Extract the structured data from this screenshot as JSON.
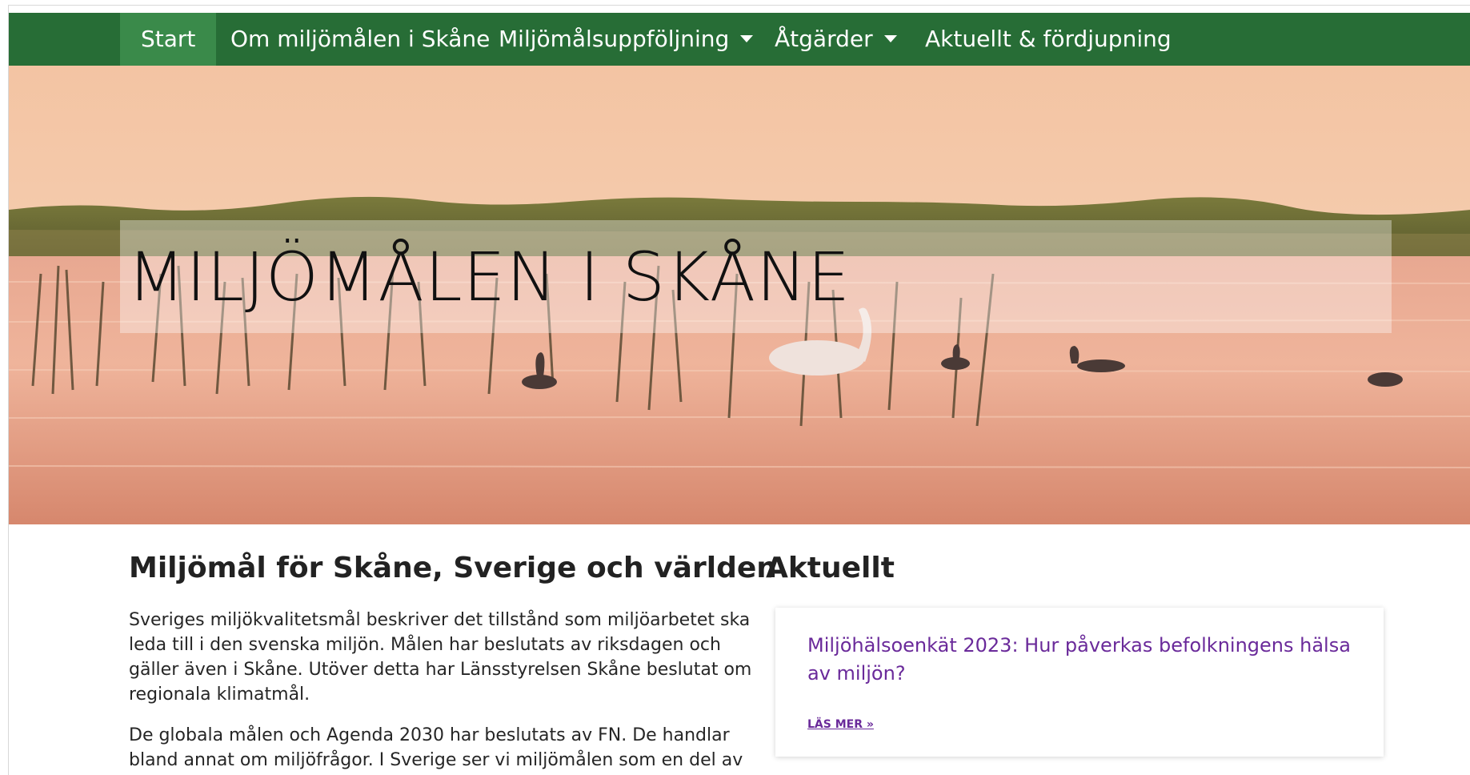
{
  "nav": {
    "items": [
      {
        "label": "Start",
        "active": true,
        "dropdown": false
      },
      {
        "label": "Om miljömålen i Skåne",
        "active": false,
        "dropdown": false
      },
      {
        "label": "Miljömålsuppföljning",
        "active": false,
        "dropdown": true
      },
      {
        "label": "Åtgärder",
        "active": false,
        "dropdown": true
      },
      {
        "label": "Aktuellt & fördjupning",
        "active": false,
        "dropdown": false
      }
    ],
    "color": "#276d36",
    "active_color": "#3a8a4a"
  },
  "hero": {
    "title": "MILJÖMÅLEN I SKÅNE",
    "image": "lake-with-reeds-and-swans-at-sunset"
  },
  "main": {
    "heading": "Miljömål för Skåne, Sverige och världen",
    "paragraphs": [
      "Sveriges miljökvalitetsmål beskriver det tillstånd som miljöarbetet ska leda till i den svenska miljön. Målen har beslutats av riksdagen och gäller även i Skåne. Utöver detta har Länsstyrelsen Skåne beslutat om regionala klimatmål.",
      "De globala målen och Agenda 2030 har beslutats av FN. De handlar bland annat om miljöfrågor. I Sverige ser vi miljömålen som en del av"
    ]
  },
  "aktuellt": {
    "heading": "Aktuellt",
    "card": {
      "title": "Miljöhälsoenkät 2023: Hur påverkas befolkningens hälsa av miljön?",
      "read_more": "LÄS MER »"
    },
    "link_color": "#6a2a9a"
  }
}
